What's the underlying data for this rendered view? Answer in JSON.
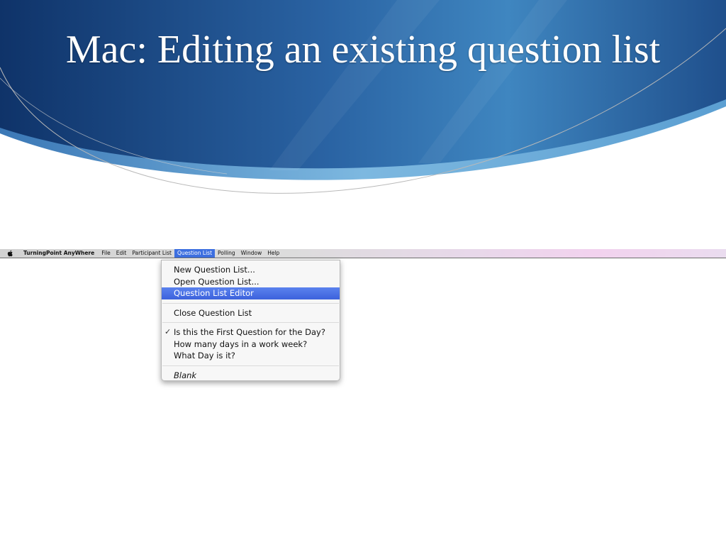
{
  "slide": {
    "title": "Mac: Editing an existing question list"
  },
  "colors": {
    "header_dark": "#123a73",
    "header_mid": "#2c6aa8",
    "header_light": "#5fa6d6",
    "menu_highlight": "#3d6fe0"
  },
  "menubar": {
    "apple_icon": "apple-icon",
    "items": [
      {
        "label": "TurningPoint AnyWhere"
      },
      {
        "label": "File"
      },
      {
        "label": "Edit"
      },
      {
        "label": "Participant List"
      },
      {
        "label": "Question List",
        "active": true
      },
      {
        "label": "Polling"
      },
      {
        "label": "Window"
      },
      {
        "label": "Help"
      }
    ]
  },
  "dropdown": {
    "groups": [
      [
        {
          "label": "New Question List..."
        },
        {
          "label": "Open Question List..."
        },
        {
          "label": "Question List Editor",
          "selected": true
        }
      ],
      [
        {
          "label": "Close Question List"
        }
      ],
      [
        {
          "label": "Is this the First Question for the Day?",
          "checked": true
        },
        {
          "label": "How many days in a work week?"
        },
        {
          "label": "What Day is it?"
        }
      ],
      [
        {
          "label": "Blank",
          "italic": true
        }
      ]
    ],
    "check_glyph": "✓"
  }
}
